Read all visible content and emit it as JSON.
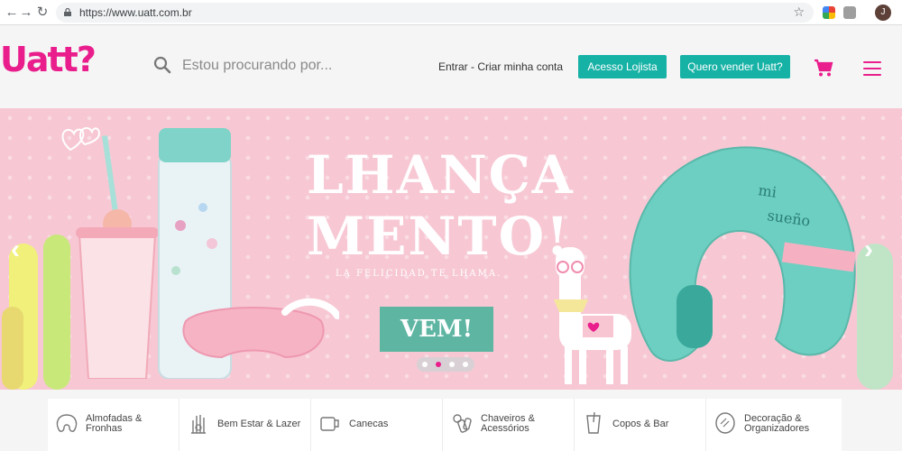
{
  "browser": {
    "url": "https://www.uatt.com.br",
    "profile_initial": "J"
  },
  "header": {
    "logo": "Uatt?",
    "search_placeholder": "Estou procurando por...",
    "login_link": "Entrar - Criar minha conta",
    "btn_lojista": "Acesso Lojista",
    "btn_vender": "Quero vender Uatt?"
  },
  "banner": {
    "headline_line1": "LHANÇA",
    "headline_line2": "MENTO!",
    "tagline": "LA FELICIDAD TE LHAMA.",
    "cta": "VEM!",
    "active_slide": 2,
    "slide_count": 4
  },
  "categories": [
    {
      "label": "Almofadas & Fronhas",
      "icon": "pillow-icon"
    },
    {
      "label": "Bem Estar & Lazer",
      "icon": "hand-icon"
    },
    {
      "label": "Canecas",
      "icon": "mug-icon"
    },
    {
      "label": "Chaveiros & Acessórios",
      "icon": "keychain-icon"
    },
    {
      "label": "Copos & Bar",
      "icon": "cup-icon"
    },
    {
      "label": "Decoração & Organizadores",
      "icon": "mirror-icon"
    }
  ],
  "colors": {
    "brand_pink": "#e91e8c",
    "teal": "#17b2a6",
    "banner_bg": "#f7c8d4",
    "cta": "#5db5a2"
  }
}
